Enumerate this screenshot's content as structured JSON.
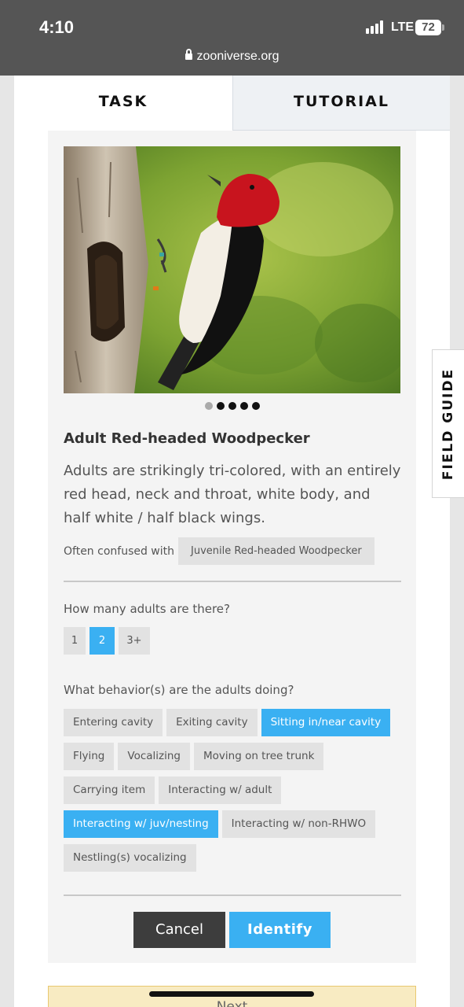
{
  "status_bar": {
    "time": "4:10",
    "network": "LTE",
    "battery": "72",
    "icons": [
      "signal-icon",
      "battery-icon"
    ]
  },
  "browser": {
    "url": "zooniverse.org",
    "icon": "lock-icon"
  },
  "tabs": [
    {
      "label": "TASK",
      "active": true
    },
    {
      "label": "TUTORIAL",
      "active": false
    }
  ],
  "field_guide": {
    "label": "FIELD GUIDE"
  },
  "species": {
    "photo_subject": "red-headed woodpecker perched on tree trunk next to cavity",
    "carousel": {
      "total": 5,
      "active_index": 0
    },
    "title": "Adult Red-headed Woodpecker",
    "description": "Adults are strikingly tri-colored, with an entirely red head, neck and throat, white body, and half white / half black wings.",
    "confused_label": "Often confused with",
    "confused_with": [
      "Juvenile Red-headed Woodpecker"
    ]
  },
  "questions": {
    "count": {
      "prompt": "How many adults are there?",
      "options": [
        {
          "label": "1",
          "selected": false
        },
        {
          "label": "2",
          "selected": true
        },
        {
          "label": "3+",
          "selected": false
        }
      ]
    },
    "behavior": {
      "prompt": "What behavior(s) are the adults doing?",
      "options": [
        {
          "label": "Entering cavity",
          "selected": false
        },
        {
          "label": "Exiting cavity",
          "selected": false
        },
        {
          "label": "Sitting in/near cavity",
          "selected": true
        },
        {
          "label": "Flying",
          "selected": false
        },
        {
          "label": "Vocalizing",
          "selected": false
        },
        {
          "label": "Moving on tree trunk",
          "selected": false
        },
        {
          "label": "Carrying item",
          "selected": false
        },
        {
          "label": "Interacting w/ adult",
          "selected": false
        },
        {
          "label": "Interacting w/ juv/nesting",
          "selected": true
        },
        {
          "label": "Interacting w/ non-RHWO",
          "selected": false
        },
        {
          "label": "Nestling(s) vocalizing",
          "selected": false
        }
      ]
    }
  },
  "actions": {
    "cancel": "Cancel",
    "identify": "Identify"
  },
  "next_bar": {
    "label": "Next"
  },
  "colors": {
    "accent": "#3ab0f2",
    "dark_button": "#3d3d3d",
    "chip": "#e2e2e2",
    "status_bar": "#555555"
  }
}
